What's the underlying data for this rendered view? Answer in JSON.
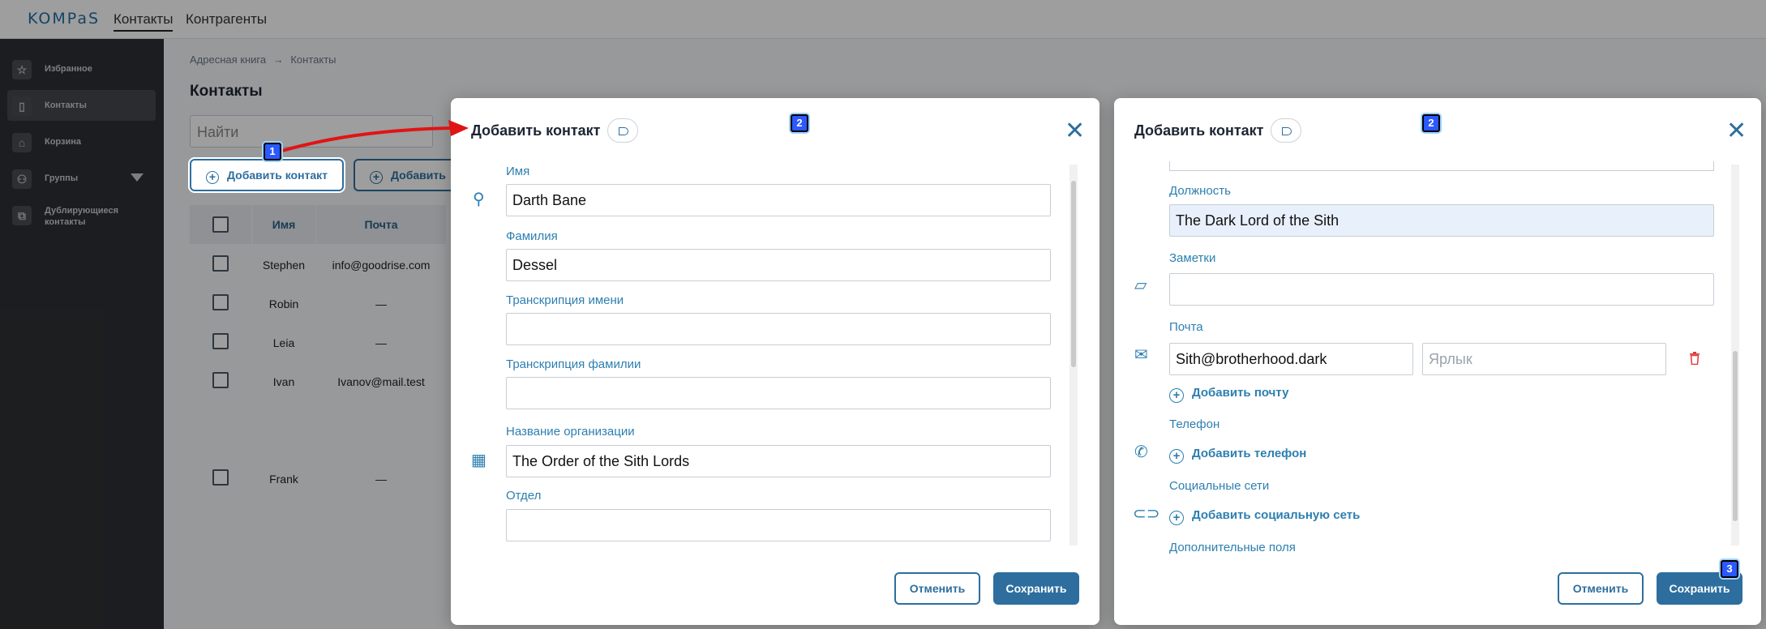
{
  "app": {
    "logo": "KOMPaS"
  },
  "topnav": {
    "contacts": "Контакты",
    "counterparties": "Контрагенты"
  },
  "sidebar": {
    "items": [
      {
        "label": "Избранное",
        "icon": "star-icon"
      },
      {
        "label": "Контакты",
        "icon": "contact-book-icon"
      },
      {
        "label": "Корзина",
        "icon": "trash-icon"
      },
      {
        "label": "Группы",
        "icon": "people-icon"
      },
      {
        "label": "Дублирующиеся контакты",
        "icon": "copy-icon"
      }
    ]
  },
  "main": {
    "breadcrumb": {
      "root": "Адресная книга",
      "separator": "→",
      "current": "Контакты"
    },
    "title": "Контакты",
    "search_placeholder": "Найти",
    "add_contact_btn": "Добавить контакт",
    "add_second_btn": "Добавить"
  },
  "table": {
    "headers": [
      "Имя",
      "Почта"
    ],
    "rows": [
      {
        "name": "Stephen",
        "email": "info@goodrise.com"
      },
      {
        "name": "Robin",
        "email": "—"
      },
      {
        "name": "Leia",
        "email": "—"
      },
      {
        "name": "Ivan",
        "email": "Ivanov@mail.test"
      },
      {
        "name": "Frank",
        "email": "—"
      }
    ]
  },
  "modal_left": {
    "title": "Добавить контакт",
    "fields": {
      "first_name": {
        "label": "Имя",
        "value": "Darth Bane"
      },
      "last_name": {
        "label": "Фамилия",
        "value": "Dessel"
      },
      "first_name_translit": {
        "label": "Транскрипция имени",
        "value": ""
      },
      "last_name_translit": {
        "label": "Транскрипция фамилии",
        "value": ""
      },
      "org": {
        "label": "Название организации",
        "value": "The Order of the Sith Lords"
      },
      "dept": {
        "label": "Отдел",
        "value": ""
      }
    },
    "cancel": "Отменить",
    "save": "Сохранить"
  },
  "modal_right": {
    "title": "Добавить контакт",
    "fields": {
      "position": {
        "label": "Должность",
        "value": "The Dark Lord of the Sith"
      },
      "notes": {
        "label": "Заметки",
        "value": ""
      },
      "email": {
        "label": "Почта",
        "value": "Sith@brotherhood.dark",
        "tag_placeholder": "Ярлык"
      },
      "phone": {
        "label": "Телефон"
      },
      "social": {
        "label": "Социальные сети"
      },
      "extra": {
        "label": "Дополнительные поля"
      }
    },
    "add_email": "Добавить почту",
    "add_phone": "Добавить телефон",
    "add_social": "Добавить социальную сеть",
    "cancel": "Отменить",
    "save": "Сохранить"
  },
  "markers": {
    "m1": "1",
    "m2": "2",
    "m3": "3"
  },
  "colors": {
    "accent": "#2d6e9e",
    "label": "#2d7fb0",
    "annotation_arrow": "#e01414",
    "marker": "#2b59ff"
  }
}
